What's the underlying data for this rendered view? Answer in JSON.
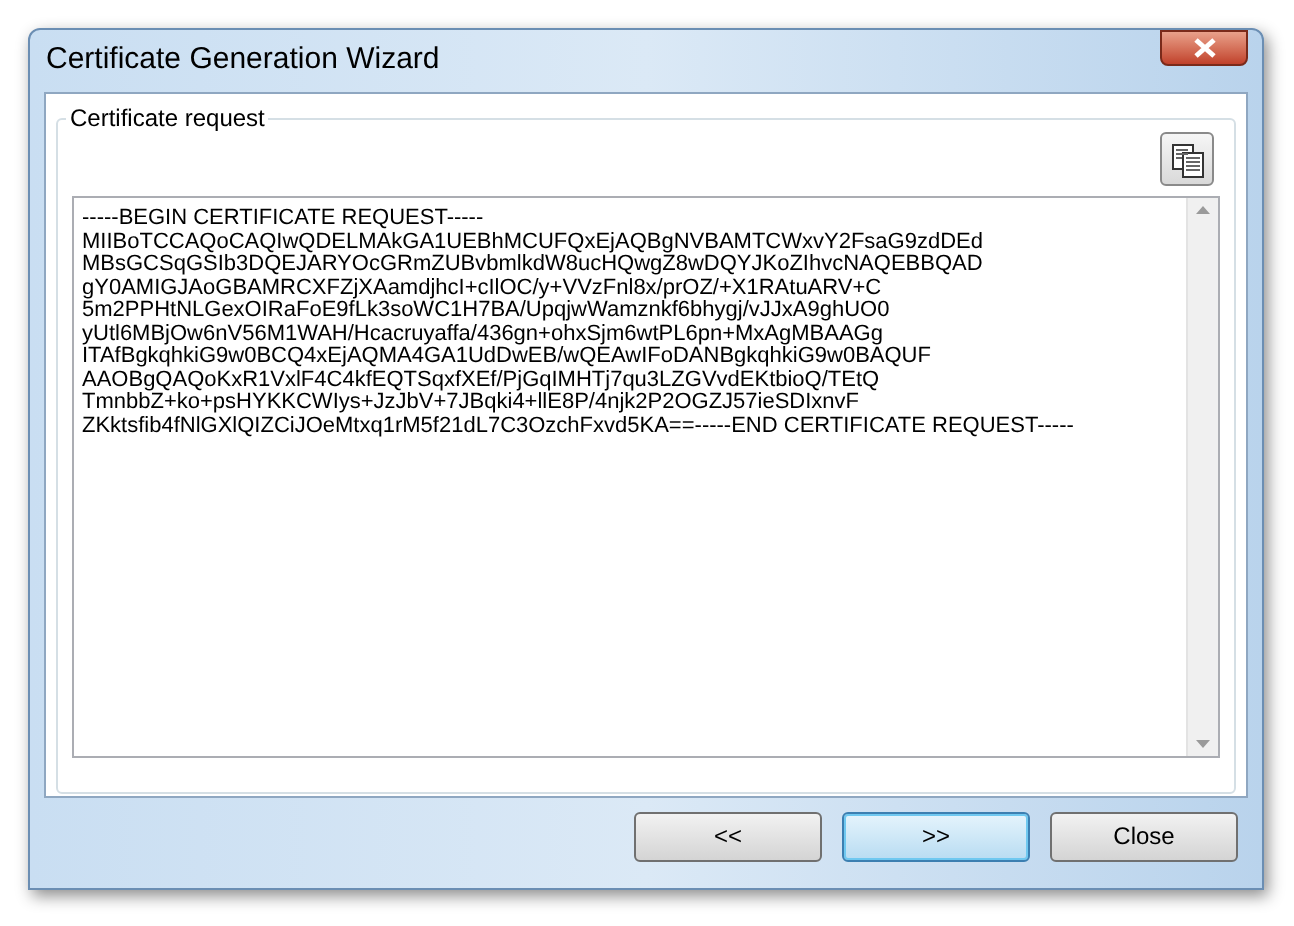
{
  "window": {
    "title": "Certificate Generation Wizard"
  },
  "group": {
    "label": "Certificate request"
  },
  "request_lines": [
    "-----BEGIN CERTIFICATE REQUEST-----",
    "MIIBoTCCAQoCAQIwQDELMAkGA1UEBhMCUFQxEjAQBgNVBAMTCWxvY2FsaG9zdDEd",
    "MBsGCSqGSIb3DQEJARYOcGRmZUBvbmlkdW8ucHQwgZ8wDQYJKoZIhvcNAQEBBQAD",
    "gY0AMIGJAoGBAMRCXFZjXAamdjhcI+cIlOC/y+VVzFnl8x/prOZ/+X1RAtuARV+C",
    "5m2PPHtNLGexOIRaFoE9fLk3soWC1H7BA/UpqjwWamznkf6bhygj/vJJxA9ghUO0",
    "yUtl6MBjOw6nV56M1WAH/Hcacruyaffa/436gn+ohxSjm6wtPL6pn+MxAgMBAAGg",
    "ITAfBgkqhkiG9w0BCQ4xEjAQMA4GA1UdDwEB/wQEAwIFoDANBgkqhkiG9w0BAQUF",
    "AAOBgQAQoKxR1VxlF4C4kfEQTSqxfXEf/PjGqIMHTj7qu3LZGVvdEKtbioQ/TEtQ",
    "TmnbbZ+ko+psHYKKCWIys+JzJbV+7JBqki4+llE8P/4njk2P2OGZJ57ieSDIxnvF",
    "ZKktsfib4fNlGXlQIZCiJOeMtxq1rM5f21dL7C3OzchFxvd5KA==-----END CERTIFICATE REQUEST-----"
  ],
  "buttons": [
    {
      "label": "<<",
      "default": false
    },
    {
      "label": ">>",
      "default": true
    },
    {
      "label": "Close",
      "default": false
    }
  ]
}
